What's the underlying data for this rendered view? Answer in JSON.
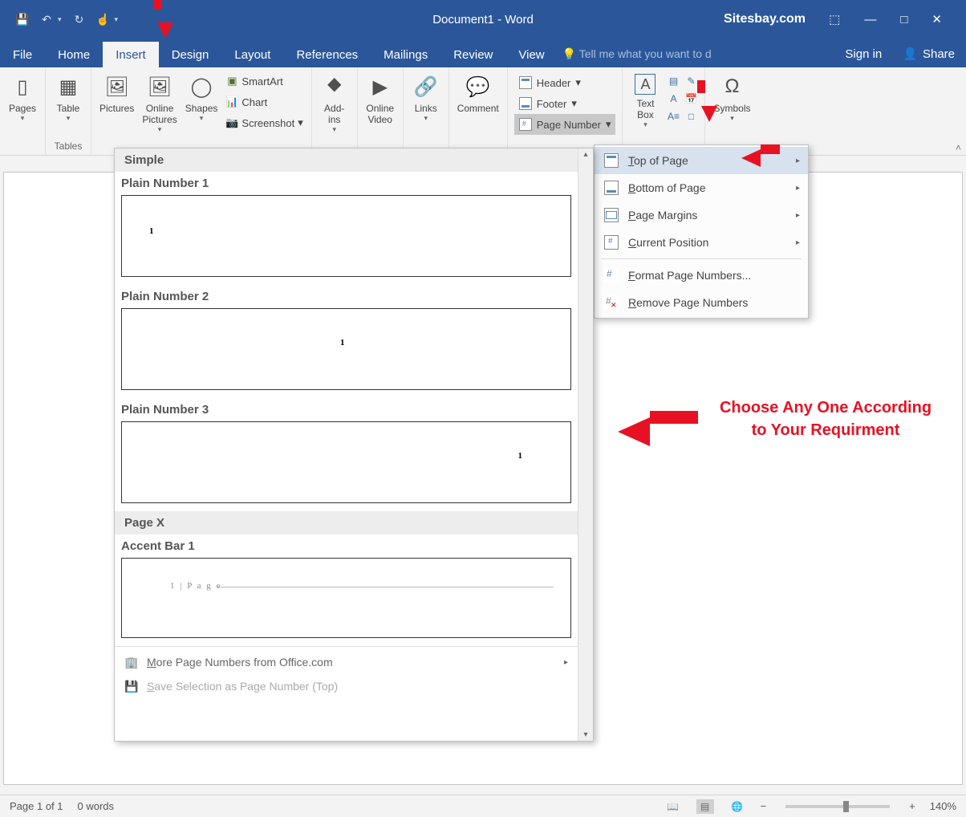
{
  "title": {
    "doc": "Document1 - Word",
    "site": "Sitesbay.com"
  },
  "tabs": {
    "file": "File",
    "home": "Home",
    "insert": "Insert",
    "design": "Design",
    "layout": "Layout",
    "references": "References",
    "mailings": "Mailings",
    "review": "Review",
    "view": "View",
    "tellme": "Tell me what you want to d",
    "signin": "Sign in",
    "share": "Share"
  },
  "ribbon": {
    "pages": "Pages",
    "table": "Table",
    "tables_grp": "Tables",
    "pictures": "Pictures",
    "online_pictures": "Online\nPictures",
    "shapes": "Shapes",
    "smartart": "SmartArt",
    "chart": "Chart",
    "screenshot": "Screenshot",
    "addins": "Add-\nins",
    "online_video": "Online\nVideo",
    "links": "Links",
    "comment": "Comment",
    "header": "Header",
    "footer": "Footer",
    "page_number": "Page Number",
    "text_box": "Text\nBox",
    "symbols": "Symbols"
  },
  "submenu": {
    "top": "Top of Page",
    "bottom": "Bottom of Page",
    "margins": "Page Margins",
    "current": "Current Position",
    "format": "Format Page Numbers...",
    "remove": "Remove Page Numbers"
  },
  "gallery": {
    "grp1": "Simple",
    "i1": "Plain Number 1",
    "i2": "Plain Number 2",
    "i3": "Plain Number 3",
    "grp2": "Page X",
    "i4": "Accent Bar 1",
    "accent_text": "1 | P a g e",
    "more": "More Page Numbers from Office.com",
    "save": "Save Selection as Page Number (Top)"
  },
  "annot": {
    "line1": "Choose Any One According",
    "line2": "to Your Requirment"
  },
  "status": {
    "page": "Page 1 of 1",
    "words": "0 words",
    "zoom": "140%",
    "minus": "−",
    "plus": "+"
  }
}
